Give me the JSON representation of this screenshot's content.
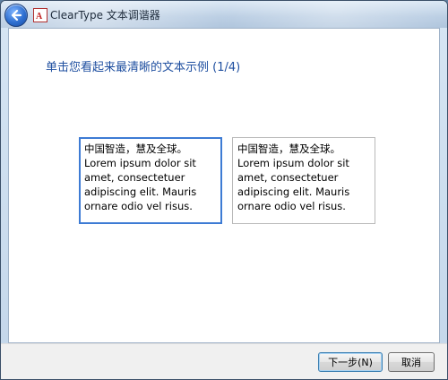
{
  "window": {
    "title": "ClearType 文本调谐器"
  },
  "icons": {
    "back": "back-arrow-icon",
    "app": "cleartype-app-icon"
  },
  "main": {
    "heading": "单击您看起来最清晰的文本示例 (1/4)",
    "samples": [
      {
        "line1": "中国智造，慧及全球。",
        "line2": "Lorem ipsum dolor sit amet, consectetuer adipiscing elit. Mauris ornare odio vel risus.",
        "selected": true
      },
      {
        "line1": "中国智造，慧及全球。",
        "line2": "Lorem ipsum dolor sit amet, consectetuer adipiscing elit. Mauris ornare odio vel risus.",
        "selected": false
      }
    ]
  },
  "buttons": {
    "next": "下一步(N)",
    "cancel": "取消"
  },
  "colors": {
    "heading": "#1f4fa0",
    "selected_border": "#3d7bd4",
    "unselected_border": "#b8b8b8"
  }
}
